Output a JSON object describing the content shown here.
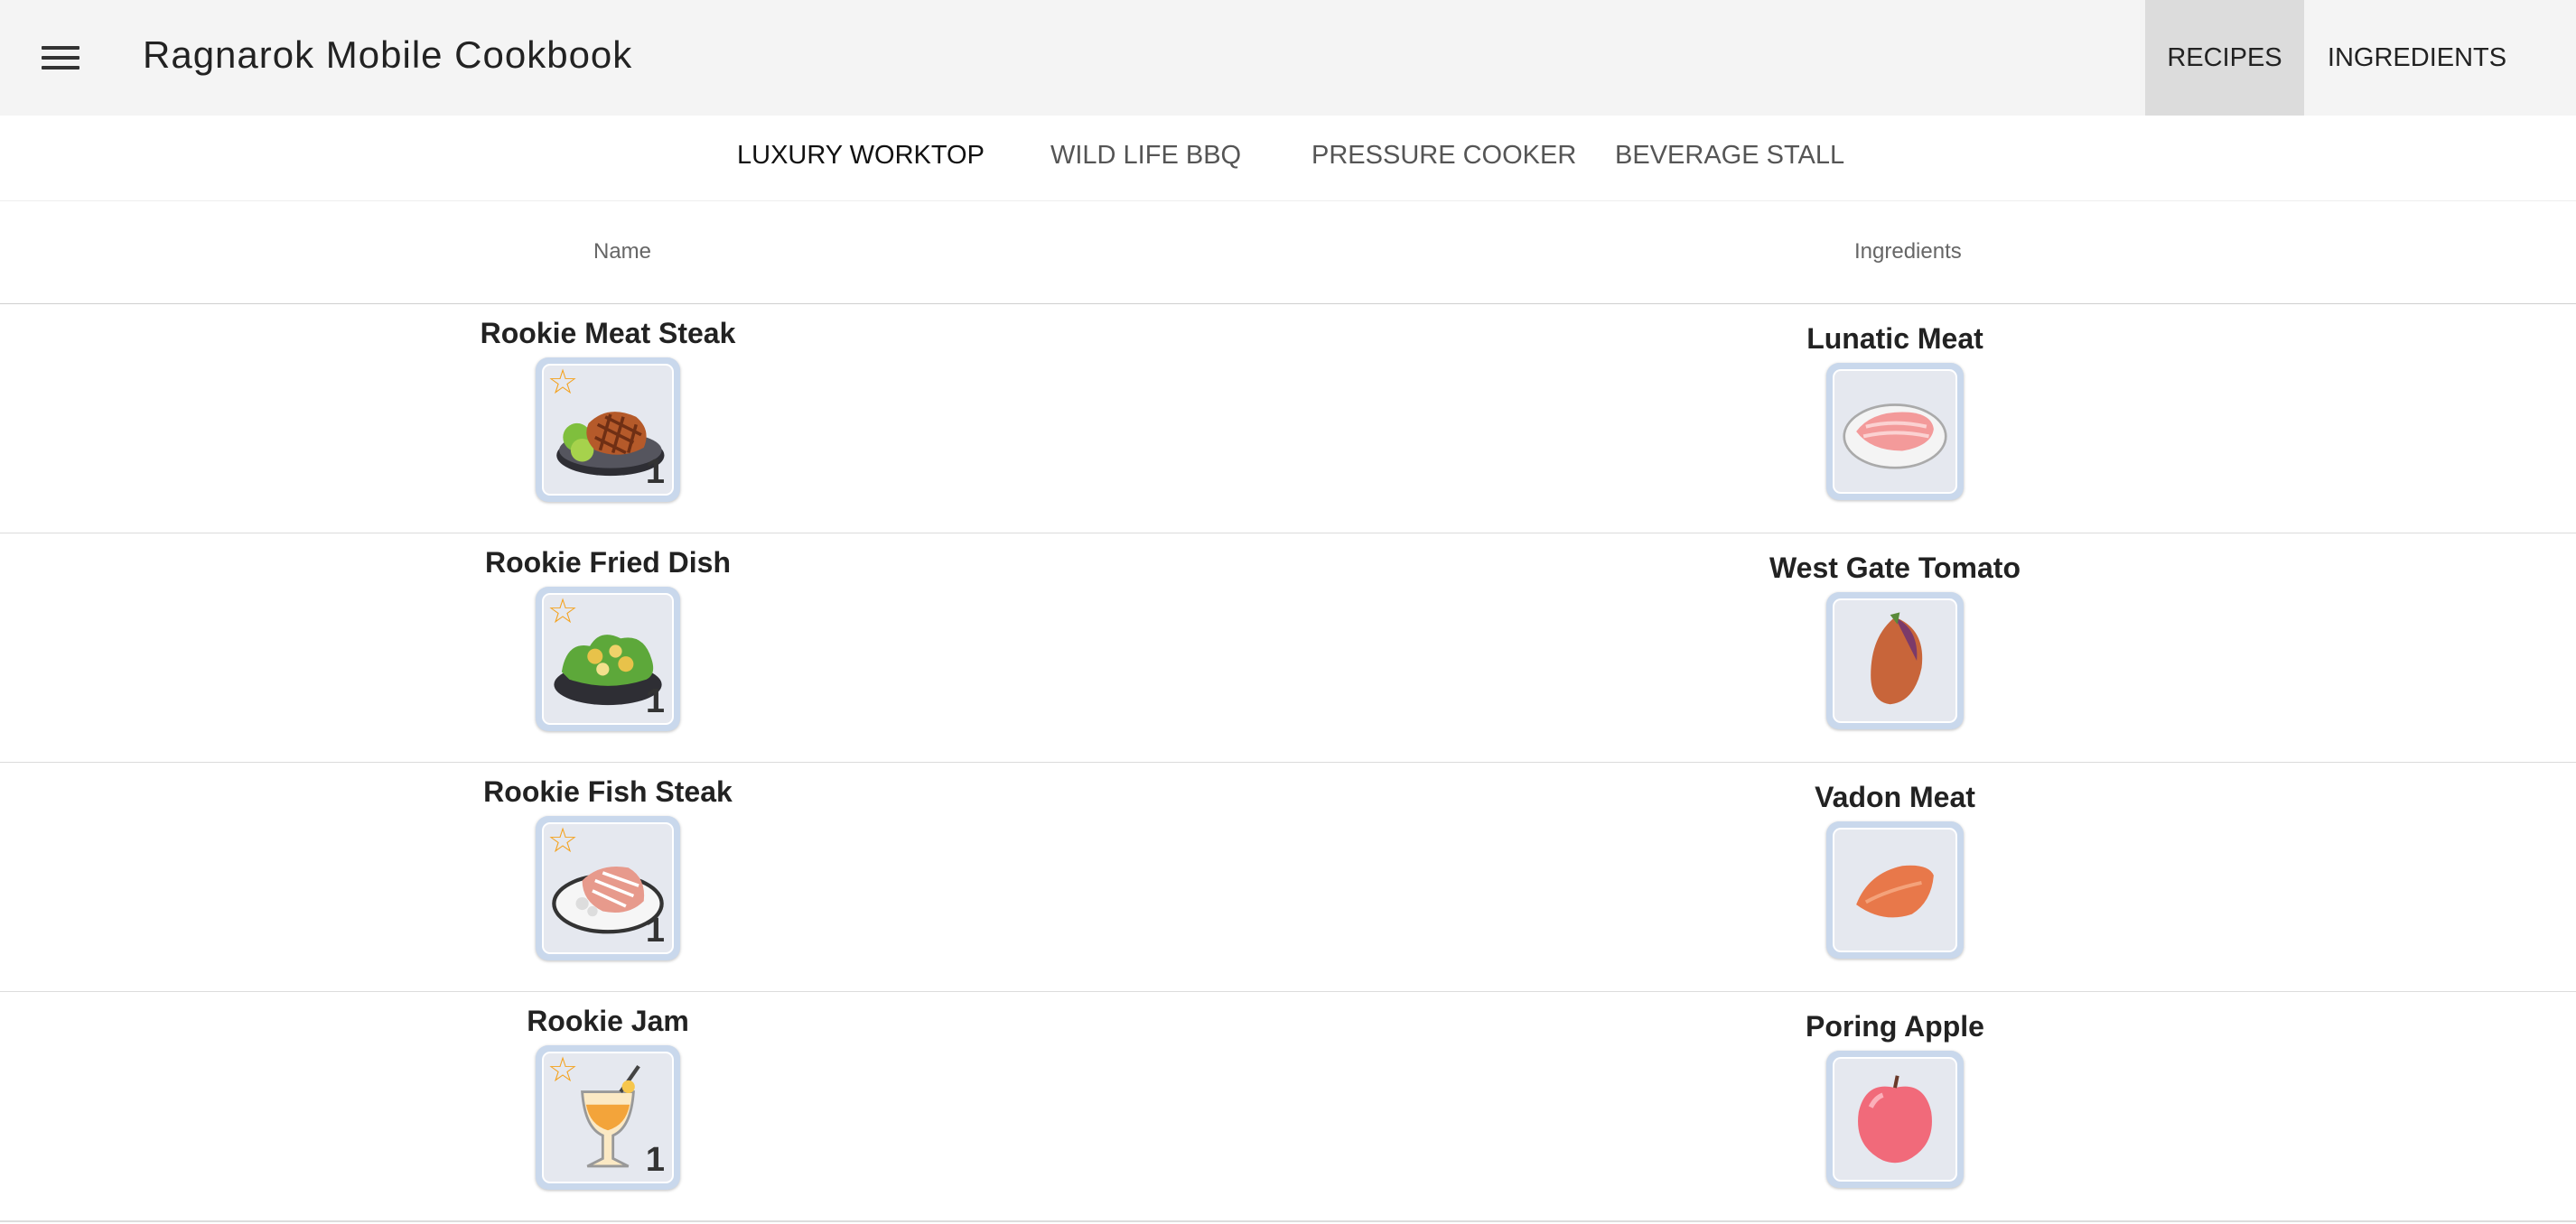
{
  "app": {
    "title": "Ragnarok Mobile Cookbook",
    "nav": {
      "recipes": "RECIPES",
      "ingredients": "INGREDIENTS"
    }
  },
  "tabs": [
    "LUXURY WORKTOP",
    "WILD LIFE BBQ",
    "PRESSURE COOKER",
    "BEVERAGE STALL"
  ],
  "table": {
    "headers": {
      "name": "Name",
      "ingredients": "Ingredients"
    },
    "rows": [
      {
        "name": "Rookie Meat Steak",
        "quantity": "1",
        "recipe_icon": "meat-steak-icon",
        "ingredient": "Lunatic Meat",
        "ingredient_icon": "lunatic-meat-icon"
      },
      {
        "name": "Rookie Fried Dish",
        "quantity": "1",
        "recipe_icon": "fried-dish-icon",
        "ingredient": "West Gate Tomato",
        "ingredient_icon": "west-gate-tomato-icon"
      },
      {
        "name": "Rookie Fish Steak",
        "quantity": "1",
        "recipe_icon": "fish-steak-icon",
        "ingredient": "Vadon Meat",
        "ingredient_icon": "vadon-meat-icon"
      },
      {
        "name": "Rookie Jam",
        "quantity": "1",
        "recipe_icon": "jam-drink-icon",
        "ingredient": "Poring Apple",
        "ingredient_icon": "poring-apple-icon"
      }
    ]
  },
  "colors": {
    "appbar_bg": "#f4f4f4",
    "active_nav_bg": "#dcdcdc",
    "star": "#f4a21e",
    "icon_frame": "#c9d8ec"
  }
}
